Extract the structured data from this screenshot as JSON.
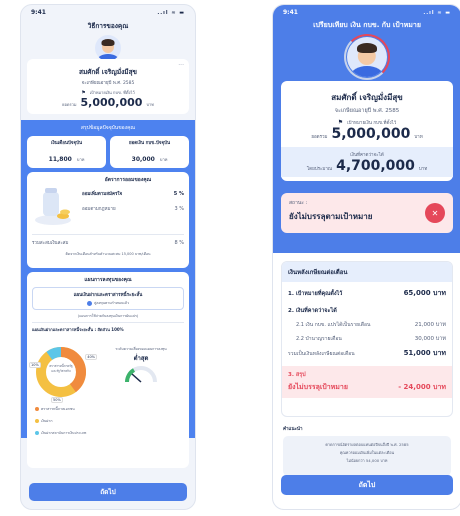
{
  "p1": {
    "time": "9:41",
    "signal": "..ıl ≈ ▬",
    "title": "วิธีการของคุณ",
    "name": "สมศักดิ์ เจริญมั่งมีสุข",
    "retire_line": "จะเกษียณอายุปี พ.ศ. 2585",
    "goal_label": "เป้าหมายเงิน กบข. ที่ตั้งไว้",
    "goal_prefix": "ยอดรวม",
    "goal_amount": "5,000,000",
    "goal_unit": "บาท",
    "summary_title": "สรุปข้อมูลปัจจุบันของคุณ",
    "s1_label": "เงินเดือนปัจจุบัน",
    "s1_value": "11,800",
    "s1_unit": "บาท",
    "s2_label": "ยอดเงิน กบข.ปัจจุบัน",
    "s2_value": "30,000",
    "s2_unit": "บาท",
    "rate_title": "อัตราการออมของคุณ",
    "rate1_label": "ออมเพิ่มตามสมัครใจ",
    "rate1_value": "5 %",
    "rate2_label": "ออมตามกฎหมาย",
    "rate2_value": "3 %",
    "total_label": "รวมสะสมเงินสะสม",
    "total_value": "8 %",
    "rate_note": "คิดจากเงินเดือนสำหรับคำนวณสะสม 15,000 บาท/เดือน",
    "plan_title": "แผนการลงทุนของคุณ",
    "plan_name": "แผนเงินฝากและตราสารหนี้ระยะสั้น",
    "plan_chip": "คู่ลงทุนตามกำหนดแล้ว",
    "plan_desc": "(แผนการใช้จ่ายกับลงทุนเงินการผันแปร)",
    "mix_label": "แผนเงินฝากและตราสารหนี้ระยะสั้น : สัดส่วน 100%",
    "donut_label": "ตราสารหนี้ภาครัฐและรัฐวิสาหกิจ",
    "donut_v1": "40%",
    "donut_v2": "50%",
    "donut_v3": "10%",
    "risk_label": "ระดับความเสี่ยงของแผนการลงทุน",
    "risk_value": "ต่ำสุด",
    "legend1": "ตราสารหนี้ภาคเอกชน",
    "legend2": "เงินฝาก",
    "legend3": "เงินฝากสถาบันการเงินประเภท",
    "next": "ถัดไป",
    "colors": {
      "legend1": "#f08b3e",
      "legend2": "#f4c042",
      "legend3": "#5cc6e8"
    }
  },
  "p2": {
    "time": "9:41",
    "signal": "..ıl ≈ ▬",
    "title": "เปรียบเทียบ เงิน กบข. กับ เป้าหมาย",
    "name": "สมศักดิ์ เจริญมั่งมีสุข",
    "retire_line": "จะเกษียณอายุปี พ.ศ. 2585",
    "goal_label": "เป้าหมายเงิน กบข.ที่ตั้งไว้",
    "goal_prefix": "ยอดรวม",
    "goal_amount": "5,000,000",
    "goal_unit": "บาท",
    "expect_label": "เงินที่คาดว่าจะได้",
    "expect_prefix": "โดยประมาณ",
    "expect_amount": "4,700,000",
    "expect_unit": "บาท",
    "status_label": "สถานะ :",
    "status_value": "ยังไม่บรรลุตามเป้าหมาย",
    "section_title": "เงินหลังเกษียณต่อเดือน",
    "l1_label": "1. เป้าหมายที่คุณตั้งไว้",
    "l1_value": "65,000 บาท",
    "l2_label": "2. เงินที่คาดว่าจะได้",
    "l21_label": "2.1 เงิน กบข. แปรได้เป็นรายเดือน",
    "l21_value": "21,000 บาท",
    "l22_label": "2.2 บำนาญรายเดือน",
    "l22_value": "30,000 บาท",
    "lsum_label": "รวมเป็นเงินหลังเกษียณต่อเดือน",
    "lsum_value": "51,000 บาท",
    "l3_label": "3. สรุป",
    "l3_status": "ยังไม่บรรลุเป้าหมาย",
    "l3_value": "- 24,000 บาท",
    "note_title": "คำแนะนำ",
    "note_line1": "คาดการณ์อัตราผลตอบแทนต่อปีจนถึงปี พ.ศ. 2585",
    "note_line2": "คุณควรออมเงินเพิ่มในแต่ละเดือน",
    "note_line3": "ไม่น้อยกว่า 54,000 บาท",
    "next": "ถัดไป"
  }
}
